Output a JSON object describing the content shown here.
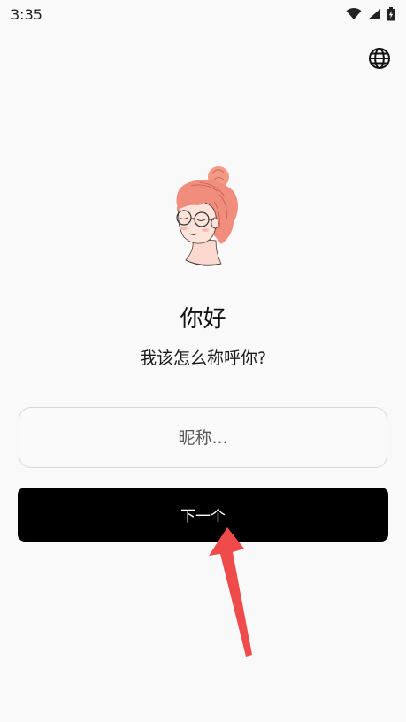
{
  "status_bar": {
    "time": "3:35",
    "icons": [
      "wifi-icon",
      "cell-signal-icon",
      "battery-charging-icon"
    ]
  },
  "header": {
    "language_icon": "globe-icon"
  },
  "main": {
    "greeting": "你好",
    "subtitle": "我该怎么称呼你?",
    "nickname_placeholder": "昵称...",
    "nickname_value": "",
    "next_label": "下一个"
  },
  "colors": {
    "background": "#f9f9f9",
    "button": "#000000",
    "button_text": "#ffffff",
    "hair": "#f08d7c",
    "arrow": "#ef4b4b"
  }
}
